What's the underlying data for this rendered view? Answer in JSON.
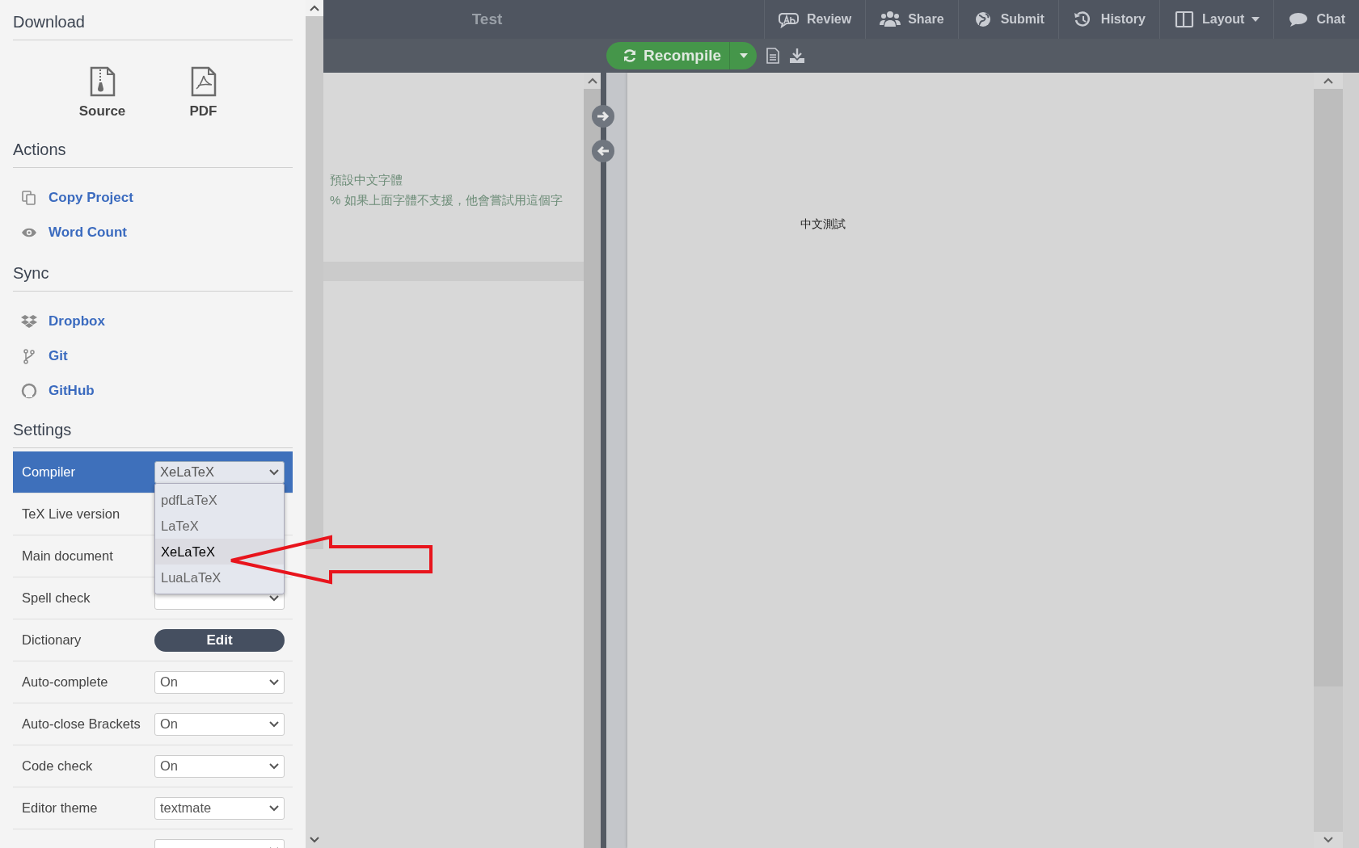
{
  "sidebar": {
    "download": {
      "heading": "Download",
      "items": [
        {
          "kind": "zip",
          "label": "Source"
        },
        {
          "kind": "pdf",
          "label": "PDF"
        }
      ]
    },
    "actions": {
      "heading": "Actions",
      "items": [
        {
          "kind": "copy",
          "label": "Copy Project"
        },
        {
          "kind": "eye",
          "label": "Word Count"
        }
      ]
    },
    "sync": {
      "heading": "Sync",
      "items": [
        {
          "kind": "dropbox",
          "label": "Dropbox"
        },
        {
          "kind": "git",
          "label": "Git"
        },
        {
          "kind": "github",
          "label": "GitHub"
        }
      ]
    },
    "settings": {
      "heading": "Settings",
      "rows": [
        {
          "kind": "select",
          "label": "Compiler",
          "value": "XeLaTeX",
          "selected": true
        },
        {
          "kind": "select",
          "label": "TeX Live version",
          "selected": false
        },
        {
          "kind": "select",
          "label": "Main document",
          "selected": false
        },
        {
          "kind": "select",
          "label": "Spell check",
          "selected": false
        },
        {
          "kind": "button",
          "label": "Dictionary",
          "value": "Edit",
          "selected": false
        },
        {
          "kind": "select",
          "label": "Auto-complete",
          "value": "On",
          "selected": false
        },
        {
          "kind": "select",
          "label": "Auto-close Brackets",
          "value": "On",
          "selected": false
        },
        {
          "kind": "select",
          "label": "Code check",
          "value": "On",
          "selected": false
        },
        {
          "kind": "select",
          "label": "Editor theme",
          "value": "textmate",
          "selected": false
        },
        {
          "kind": "select",
          "selected": false
        }
      ]
    },
    "compiler_menu": {
      "options": [
        {
          "label": "pdfLaTeX",
          "selected": false
        },
        {
          "label": "LaTeX",
          "selected": false
        },
        {
          "label": "XeLaTeX",
          "selected": true
        },
        {
          "label": "LuaLaTeX",
          "selected": false
        }
      ]
    }
  },
  "toolbar": {
    "title": "Test",
    "items": [
      {
        "kind": "review",
        "label": "Review"
      },
      {
        "kind": "share",
        "label": "Share"
      },
      {
        "kind": "submit",
        "label": "Submit"
      },
      {
        "kind": "history",
        "label": "History"
      },
      {
        "kind": "layout",
        "label": "Layout",
        "caret": true
      },
      {
        "kind": "chat",
        "label": "Chat"
      }
    ]
  },
  "compile_bar": {
    "button": "Recompile"
  },
  "editor": {
    "lines": [
      "預設中文字體",
      "% 如果上面字體不支援，他會嘗試用這個字"
    ]
  },
  "pdf": {
    "text": "中文測試"
  }
}
